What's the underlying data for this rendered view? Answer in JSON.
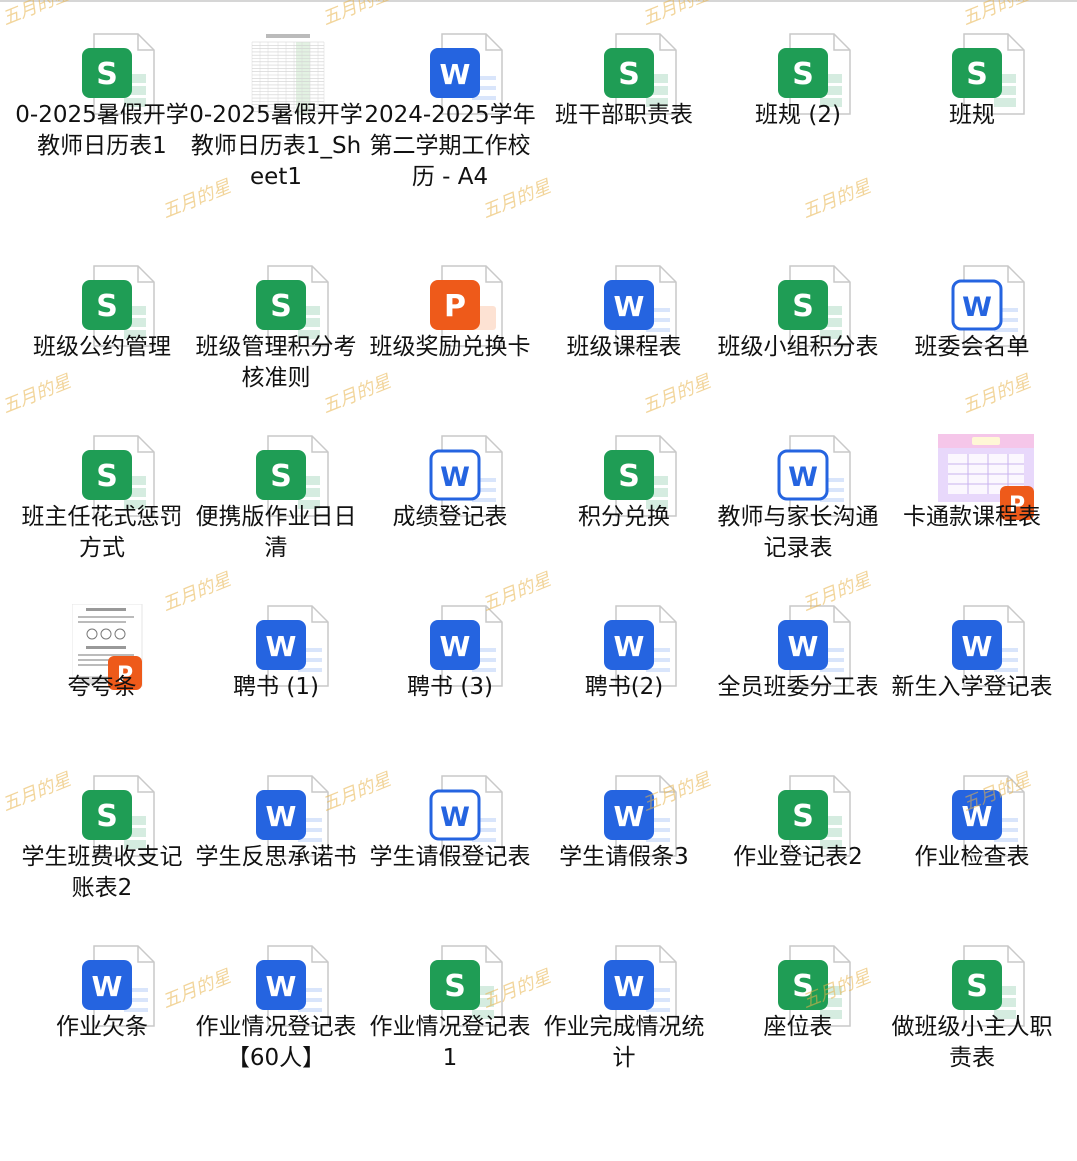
{
  "watermark": "五月的星",
  "colors": {
    "sheet": "#1f9d55",
    "sheet_light": "#d5ece0",
    "word": "#2564e0",
    "word_light": "#d9e5fb",
    "ppt": "#ee5a1a",
    "ppt_light": "#fde2d3"
  },
  "files": [
    {
      "label": "0-2025暑假开学教师日历表1",
      "type": "sheet",
      "letter": "S"
    },
    {
      "label": "0-2025暑假开学教师日历表1_Sheet1",
      "type": "thumb-sheet",
      "letter": ""
    },
    {
      "label": "2024-2025学年第二学期工作校历 - A4",
      "type": "word",
      "letter": "W"
    },
    {
      "label": "班干部职责表",
      "type": "sheet",
      "letter": "S"
    },
    {
      "label": "班规 (2)",
      "type": "sheet",
      "letter": "S"
    },
    {
      "label": "班规",
      "type": "sheet",
      "letter": "S"
    },
    {
      "label": "班级公约管理",
      "type": "sheet",
      "letter": "S"
    },
    {
      "label": "班级管理积分考核准则",
      "type": "sheet",
      "letter": "S"
    },
    {
      "label": "班级奖励兑换卡",
      "type": "ppt",
      "letter": "P"
    },
    {
      "label": "班级课程表",
      "type": "word",
      "letter": "W"
    },
    {
      "label": "班级小组积分表",
      "type": "sheet",
      "letter": "S"
    },
    {
      "label": "班委会名单",
      "type": "word-outline",
      "letter": "W"
    },
    {
      "label": "班主任花式惩罚方式",
      "type": "sheet",
      "letter": "S"
    },
    {
      "label": "便携版作业日日清",
      "type": "sheet",
      "letter": "S"
    },
    {
      "label": "成绩登记表",
      "type": "word-outline",
      "letter": "W"
    },
    {
      "label": "积分兑换",
      "type": "sheet",
      "letter": "S"
    },
    {
      "label": "教师与家长沟通记录表",
      "type": "word-outline",
      "letter": "W"
    },
    {
      "label": "卡通款课程表",
      "type": "thumb-ppt-color",
      "letter": "P"
    },
    {
      "label": "夸夸条",
      "type": "thumb-ppt",
      "letter": "P"
    },
    {
      "label": "聘书 (1)",
      "type": "word",
      "letter": "W"
    },
    {
      "label": "聘书 (3)",
      "type": "word",
      "letter": "W"
    },
    {
      "label": "聘书(2)",
      "type": "word",
      "letter": "W"
    },
    {
      "label": "全员班委分工表",
      "type": "word",
      "letter": "W"
    },
    {
      "label": "新生入学登记表",
      "type": "word",
      "letter": "W"
    },
    {
      "label": "学生班费收支记账表2",
      "type": "sheet",
      "letter": "S"
    },
    {
      "label": "学生反思承诺书",
      "type": "word",
      "letter": "W"
    },
    {
      "label": "学生请假登记表",
      "type": "word-outline",
      "letter": "W"
    },
    {
      "label": "学生请假条3",
      "type": "word",
      "letter": "W"
    },
    {
      "label": "作业登记表2",
      "type": "sheet",
      "letter": "S"
    },
    {
      "label": "作业检查表",
      "type": "word",
      "letter": "W"
    },
    {
      "label": "作业欠条",
      "type": "word",
      "letter": "W"
    },
    {
      "label": "作业情况登记表【60人】",
      "type": "word",
      "letter": "W"
    },
    {
      "label": "作业情况登记表1",
      "type": "sheet",
      "letter": "S"
    },
    {
      "label": "作业完成情况统计",
      "type": "word",
      "letter": "W"
    },
    {
      "label": "座位表",
      "type": "sheet",
      "letter": "S"
    },
    {
      "label": "做班级小主人职责表",
      "type": "sheet",
      "letter": "S"
    }
  ]
}
